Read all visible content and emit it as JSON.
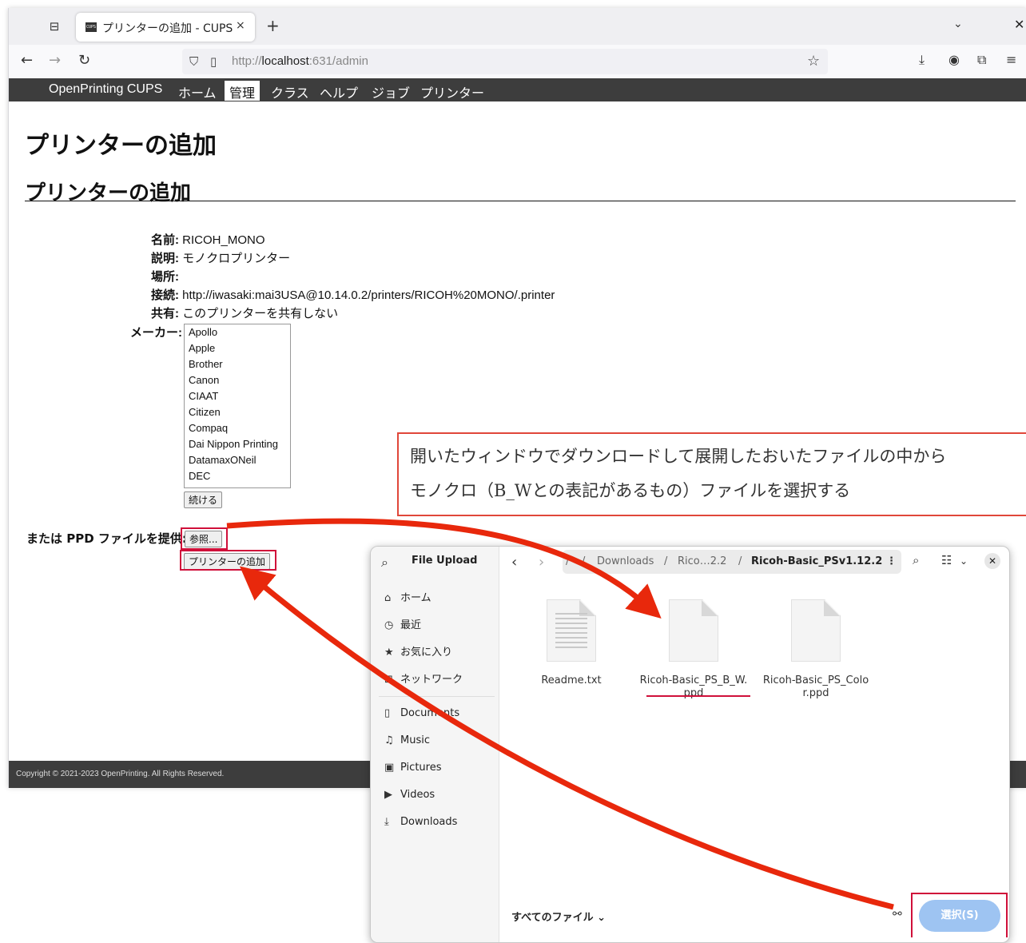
{
  "browser": {
    "tab_title": "プリンターの追加 - CUPS",
    "tab_favicon": "CUPS",
    "tab_close": "×",
    "new_tab": "+",
    "url_prefix": "http://",
    "url_host": "localhost",
    "url_rest": ":631/admin"
  },
  "cups_nav": {
    "brand": "OpenPrinting CUPS",
    "items": [
      "ホーム",
      "管理",
      "クラス",
      "ヘルプ",
      "ジョブ",
      "プリンター"
    ],
    "active": "管理"
  },
  "page": {
    "title": "プリンターの追加",
    "section_title": "プリンターの追加",
    "fields": [
      {
        "label": "名前:",
        "value": "RICOH_MONO"
      },
      {
        "label": "説明:",
        "value": "モノクロプリンター"
      },
      {
        "label": "場所:",
        "value": ""
      },
      {
        "label": "接続:",
        "value": "http://iwasaki:mai3USA@10.14.0.2/printers/RICOH%20MONO/.printer"
      },
      {
        "label": "共有:",
        "value": "このプリンターを共有しない"
      }
    ],
    "maker_label": "メーカー:",
    "makers": [
      "Apollo",
      "Apple",
      "Brother",
      "Canon",
      "CIAAT",
      "Citizen",
      "Compaq",
      "Dai Nippon Printing",
      "DatamaxONeil",
      "DEC"
    ],
    "continue_button": "続ける",
    "ppd_label": "または PPD ファイルを提供:",
    "browse_button": "参照...",
    "add_printer_button": "プリンターの追加",
    "footer": "Copyright © 2021-2023 OpenPrinting. All Rights Reserved."
  },
  "annotation": {
    "line1": "開いたウィンドウでダウンロードして展開したおいたファイルの中から",
    "line2": "モノクロ（B_Wとの表記があるもの）ファイルを選択する",
    "color": "#e0473a"
  },
  "dialog": {
    "title": "File Upload",
    "sidebar": [
      {
        "icon": "home-icon",
        "label": "ホーム"
      },
      {
        "icon": "clock-icon",
        "label": "最近"
      },
      {
        "icon": "star-icon",
        "label": "お気に入り"
      },
      {
        "icon": "network-icon",
        "label": "ネットワーク"
      },
      {
        "icon": "document-icon",
        "label": "Documents"
      },
      {
        "icon": "music-icon",
        "label": "Music"
      },
      {
        "icon": "pictures-icon",
        "label": "Pictures"
      },
      {
        "icon": "videos-icon",
        "label": "Videos"
      },
      {
        "icon": "download-icon",
        "label": "Downloads"
      }
    ],
    "breadcrumb": {
      "root": "/",
      "sep": "/",
      "downloads": "Downloads",
      "middle": "Rico…2.2",
      "current": "Ricoh-Basic_PSv1.12.2"
    },
    "files": [
      {
        "name": "Readme.txt",
        "type": "text"
      },
      {
        "name": "Ricoh-Basic_PS_B_W.ppd",
        "type": "ppd"
      },
      {
        "name": "Ricoh-Basic_PS_Color.ppd",
        "type": "ppd"
      }
    ],
    "filter": "すべてのファイル",
    "select_button": "選択(S)"
  },
  "colors": {
    "highlight": "#d0103a",
    "arrow": "#e8280c",
    "cups_bar": "#3d3d3d",
    "select_button": "#9ec4f2"
  }
}
